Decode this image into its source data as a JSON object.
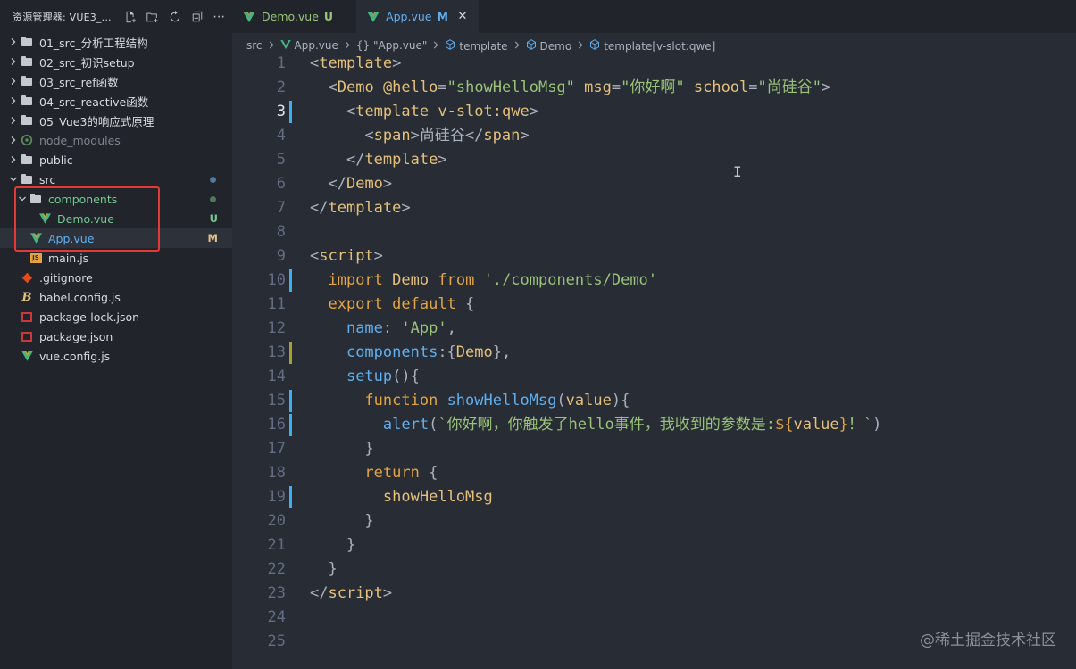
{
  "sidebar": {
    "title": "资源管理器: VUE3_...",
    "actions": [
      "new-file-icon",
      "new-folder-icon",
      "refresh-icon",
      "collapse-icon",
      "more-icon"
    ],
    "items": [
      {
        "label": "01_src_分析工程结构",
        "type": "folder",
        "depth": 0,
        "expanded": false
      },
      {
        "label": "02_src_初识setup",
        "type": "folder",
        "depth": 0,
        "expanded": false
      },
      {
        "label": "03_src_ref函数",
        "type": "folder",
        "depth": 0,
        "expanded": false
      },
      {
        "label": "04_src_reactive函数",
        "type": "folder",
        "depth": 0,
        "expanded": false
      },
      {
        "label": "05_Vue3的响应式原理",
        "type": "folder",
        "depth": 0,
        "expanded": false
      },
      {
        "label": "node_modules",
        "type": "node_modules",
        "depth": 0,
        "expanded": false,
        "dim": true
      },
      {
        "label": "public",
        "type": "folder",
        "depth": 0,
        "expanded": false
      },
      {
        "label": "src",
        "type": "folder",
        "depth": 0,
        "expanded": true,
        "dot": true
      },
      {
        "label": "components",
        "type": "folder",
        "depth": 1,
        "expanded": true,
        "dot": true,
        "green": true
      },
      {
        "label": "Demo.vue",
        "type": "vue",
        "depth": 2,
        "badge": "U",
        "green": true
      },
      {
        "label": "App.vue",
        "type": "vue",
        "depth": 1,
        "badge": "M",
        "selected": true,
        "blue": true
      },
      {
        "label": "main.js",
        "type": "js",
        "depth": 1
      },
      {
        "label": ".gitignore",
        "type": "git",
        "depth": 0
      },
      {
        "label": "babel.config.js",
        "type": "babel",
        "depth": 0
      },
      {
        "label": "package-lock.json",
        "type": "npm",
        "depth": 0
      },
      {
        "label": "package.json",
        "type": "npm",
        "depth": 0
      },
      {
        "label": "vue.config.js",
        "type": "vue",
        "depth": 0
      }
    ]
  },
  "tabs": [
    {
      "label": "Demo.vue",
      "badge": "U",
      "active": false
    },
    {
      "label": "App.vue",
      "badge": "M",
      "active": true,
      "close": "✕"
    }
  ],
  "breadcrumb": [
    "src",
    "App.vue",
    "{} \"App.vue\"",
    "template",
    "Demo",
    "template[v-slot:qwe]"
  ],
  "code": {
    "current_line": 3,
    "lines": [
      [
        [
          "t-punc",
          "<"
        ],
        [
          "t-tag",
          "template"
        ],
        [
          "t-punc",
          ">"
        ]
      ],
      [
        [
          "t-plain",
          "  "
        ],
        [
          "t-punc",
          "<"
        ],
        [
          "t-tag",
          "Demo"
        ],
        [
          "t-plain",
          " "
        ],
        [
          "t-attr",
          "@hello"
        ],
        [
          "t-punc",
          "="
        ],
        [
          "t-str",
          "\"showHelloMsg\""
        ],
        [
          "t-plain",
          " "
        ],
        [
          "t-attr",
          "msg"
        ],
        [
          "t-punc",
          "="
        ],
        [
          "t-str",
          "\"你好啊\""
        ],
        [
          "t-plain",
          " "
        ],
        [
          "t-attr",
          "school"
        ],
        [
          "t-punc",
          "="
        ],
        [
          "t-str",
          "\"尚硅谷\""
        ],
        [
          "t-punc",
          ">"
        ]
      ],
      [
        [
          "t-plain",
          "    "
        ],
        [
          "t-punc",
          "<"
        ],
        [
          "t-tag",
          "template"
        ],
        [
          "t-plain",
          " "
        ],
        [
          "t-attr",
          "v-slot:qwe"
        ],
        [
          "t-punc",
          ">"
        ]
      ],
      [
        [
          "t-plain",
          "      "
        ],
        [
          "t-punc",
          "<"
        ],
        [
          "t-tag",
          "span"
        ],
        [
          "t-punc",
          ">"
        ],
        [
          "t-plain",
          "尚硅谷"
        ],
        [
          "t-punc",
          "</"
        ],
        [
          "t-tag",
          "span"
        ],
        [
          "t-punc",
          ">"
        ]
      ],
      [
        [
          "t-plain",
          "    "
        ],
        [
          "t-punc",
          "</"
        ],
        [
          "t-tag",
          "template"
        ],
        [
          "t-punc",
          ">"
        ]
      ],
      [
        [
          "t-plain",
          "  "
        ],
        [
          "t-punc",
          "</"
        ],
        [
          "t-tag",
          "Demo"
        ],
        [
          "t-punc",
          ">"
        ]
      ],
      [
        [
          "t-punc",
          "</"
        ],
        [
          "t-tag",
          "template"
        ],
        [
          "t-punc",
          ">"
        ]
      ],
      [],
      [
        [
          "t-punc",
          "<"
        ],
        [
          "t-tag",
          "script"
        ],
        [
          "t-punc",
          ">"
        ]
      ],
      [
        [
          "t-plain",
          "  "
        ],
        [
          "t-kw",
          "import"
        ],
        [
          "t-plain",
          " "
        ],
        [
          "t-var",
          "Demo"
        ],
        [
          "t-plain",
          " "
        ],
        [
          "t-kw",
          "from"
        ],
        [
          "t-plain",
          " "
        ],
        [
          "t-str",
          "'./components/Demo'"
        ]
      ],
      [
        [
          "t-plain",
          "  "
        ],
        [
          "t-kw",
          "export"
        ],
        [
          "t-plain",
          " "
        ],
        [
          "t-kw",
          "default"
        ],
        [
          "t-plain",
          " {"
        ]
      ],
      [
        [
          "t-plain",
          "    "
        ],
        [
          "t-key",
          "name"
        ],
        [
          "t-plain",
          ": "
        ],
        [
          "t-str",
          "'App'"
        ],
        [
          "t-plain",
          ","
        ]
      ],
      [
        [
          "t-plain",
          "    "
        ],
        [
          "t-key",
          "components"
        ],
        [
          "t-plain",
          ":{"
        ],
        [
          "t-var",
          "Demo"
        ],
        [
          "t-plain",
          "},"
        ]
      ],
      [
        [
          "t-plain",
          "    "
        ],
        [
          "t-fn",
          "setup"
        ],
        [
          "t-plain",
          "(){"
        ]
      ],
      [
        [
          "t-plain",
          "      "
        ],
        [
          "t-kw",
          "function"
        ],
        [
          "t-plain",
          " "
        ],
        [
          "t-fn",
          "showHelloMsg"
        ],
        [
          "t-plain",
          "("
        ],
        [
          "t-param",
          "value"
        ],
        [
          "t-plain",
          "){"
        ]
      ],
      [
        [
          "t-plain",
          "        "
        ],
        [
          "t-fn",
          "alert"
        ],
        [
          "t-plain",
          "("
        ],
        [
          "t-str",
          "`你好啊，你触发了hello事件，我收到的参数是:"
        ],
        [
          "t-kw",
          "${"
        ],
        [
          "t-param",
          "value"
        ],
        [
          "t-kw",
          "}"
        ],
        [
          "t-str",
          "！`"
        ],
        [
          "t-plain",
          ")"
        ]
      ],
      [
        [
          "t-plain",
          "      }"
        ]
      ],
      [
        [
          "t-plain",
          "      "
        ],
        [
          "t-kw",
          "return"
        ],
        [
          "t-plain",
          " {"
        ]
      ],
      [
        [
          "t-plain",
          "        "
        ],
        [
          "t-var",
          "showHelloMsg"
        ]
      ],
      [
        [
          "t-plain",
          "      }"
        ]
      ],
      [
        [
          "t-plain",
          "    }"
        ]
      ],
      [
        [
          "t-plain",
          "  }"
        ]
      ],
      [
        [
          "t-punc",
          "</"
        ],
        [
          "t-tag",
          "script"
        ],
        [
          "t-punc",
          ">"
        ]
      ],
      [],
      []
    ],
    "gutter_marks": {
      "3": "#3fb0ee",
      "10": "#3fb0ee",
      "13": "#a8a035",
      "15": "#3fb0ee",
      "16": "#3fb0ee",
      "19": "#3fb0ee"
    }
  },
  "watermark": "@稀土掘金技术社区",
  "colors": {
    "accent": "#61afef",
    "untracked": "#73c991",
    "modified": "#e2c08d",
    "highlight_box": "#e53935"
  }
}
